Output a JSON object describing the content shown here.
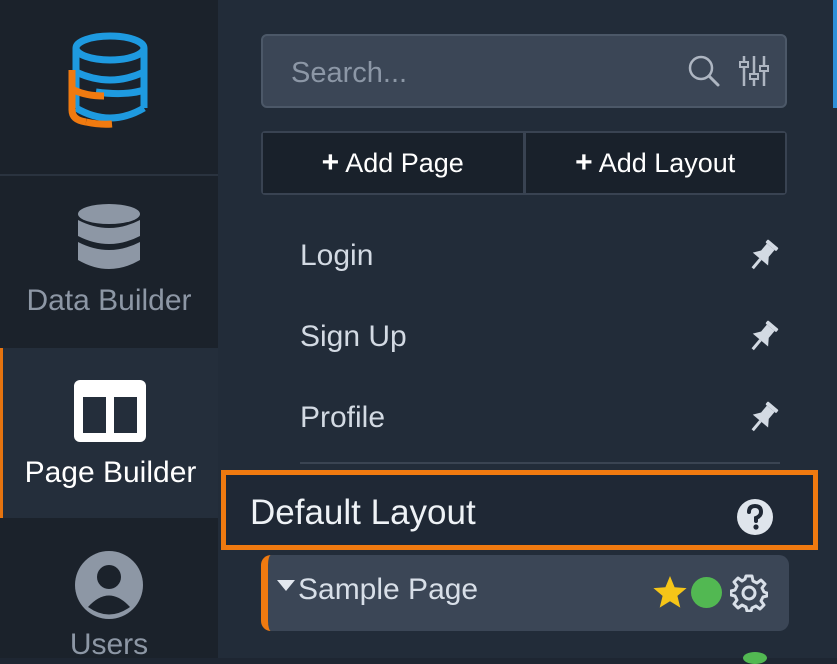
{
  "rail": {
    "logo": "database-logo",
    "items": [
      {
        "label": "Data Builder",
        "icon": "database-icon",
        "active": false
      },
      {
        "label": "Page Builder",
        "icon": "columns-layout-icon",
        "active": true
      },
      {
        "label": "Users",
        "icon": "user-circle-icon",
        "active": false
      }
    ]
  },
  "search": {
    "placeholder": "Search...",
    "value": ""
  },
  "actions": {
    "add_page": "Add Page",
    "add_layout": "Add Layout",
    "plus": "+"
  },
  "pages": [
    {
      "label": "Login",
      "icon": "pin-icon"
    },
    {
      "label": "Sign Up",
      "icon": "pin-icon"
    },
    {
      "label": "Profile",
      "icon": "pin-icon"
    }
  ],
  "layout_section": {
    "title": "Default Layout",
    "icon": "help-icon"
  },
  "layout_pages": [
    {
      "label": "Sample Page",
      "favorite": true,
      "status": "published"
    }
  ],
  "colors": {
    "accent": "#f07a10",
    "status_green": "#52b852",
    "star": "#f5c518",
    "scroll_accent": "#2e8fd8"
  }
}
